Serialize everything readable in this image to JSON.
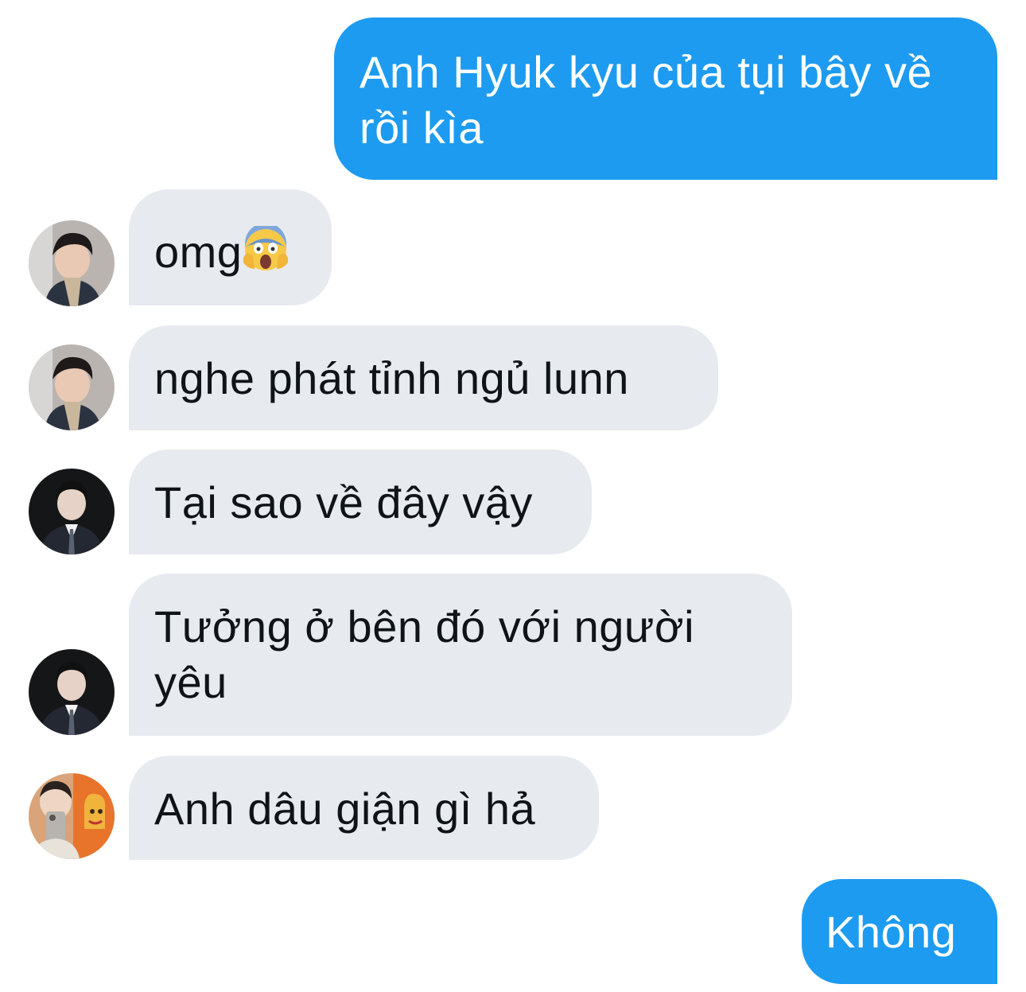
{
  "messages": [
    {
      "sender": "me",
      "text": "Anh Hyuk kyu của tụi bây về rồi kìa"
    },
    {
      "sender": "user1",
      "text": "omg",
      "emoji": "face-screaming-in-fear"
    },
    {
      "sender": "user1",
      "text": "nghe phát tỉnh ngủ lunn"
    },
    {
      "sender": "user2",
      "text": "Tại sao về đây vậy"
    },
    {
      "sender": "user2",
      "text": "Tưởng ở bên đó với người yêu"
    },
    {
      "sender": "user3",
      "text": "Anh dâu giận gì hả"
    },
    {
      "sender": "me",
      "text": "Không"
    }
  ],
  "colors": {
    "sent_bubble": "#1d9bf0",
    "received_bubble": "#e7ebf0",
    "received_text": "#0f1419"
  },
  "icons": {
    "avatar_1": "avatar-photo-dark-hair-scarf",
    "avatar_2": "avatar-photo-suit",
    "avatar_3": "avatar-photo-phone-selfie"
  }
}
